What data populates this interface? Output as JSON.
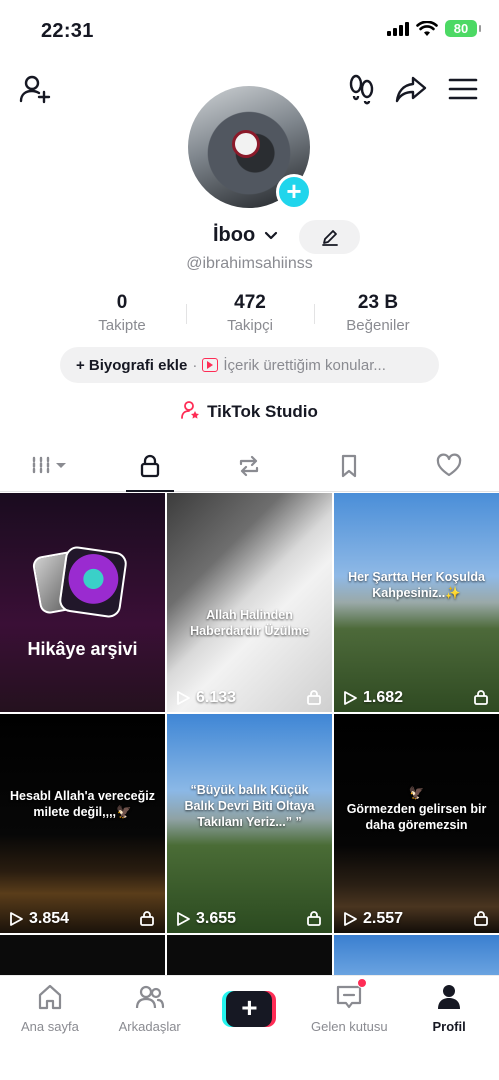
{
  "status_bar": {
    "time": "22:31",
    "battery": "80"
  },
  "profile": {
    "name": "İboo",
    "handle": "@ibrahimsahiinss"
  },
  "stats": [
    {
      "num": "0",
      "label": "Takipte"
    },
    {
      "num": "472",
      "label": "Takipçi"
    },
    {
      "num": "23 B",
      "label": "Beğeniler"
    }
  ],
  "bio": {
    "add_label": "+ Biyografi ekle",
    "separator": "·",
    "topic_label": "İçerik ürettiğim konular..."
  },
  "studio_label": "TikTok Studio",
  "tabs": [
    "grid-menu-icon",
    "lock-icon",
    "repost-icon",
    "bookmark-icon",
    "heart-icon"
  ],
  "videos": [
    {
      "type": "archive",
      "label": "Hikâye arşivi"
    },
    {
      "caption": "Allah Halinden Haberdardır Üzülme",
      "views": "6.133"
    },
    {
      "caption": "Her Şartta Her Koşulda Kahpesiniz..✨",
      "views": "1.682"
    },
    {
      "caption": "Hesabl Allah'a vereceğiz milete değil,,,,🦅",
      "views": "3.854"
    },
    {
      "caption": "“Büyük balık Küçük Balık Devri Biti Oltaya Takılanı Yeriz...” ”",
      "views": "3.655"
    },
    {
      "caption": "🦅\nGörmezden gelirsen bir daha göremezsin",
      "views": "2.557"
    }
  ],
  "nav": {
    "home": "Ana sayfa",
    "friends": "Arkadaşlar",
    "create": "+",
    "inbox": "Gelen kutusu",
    "profile": "Profil"
  }
}
